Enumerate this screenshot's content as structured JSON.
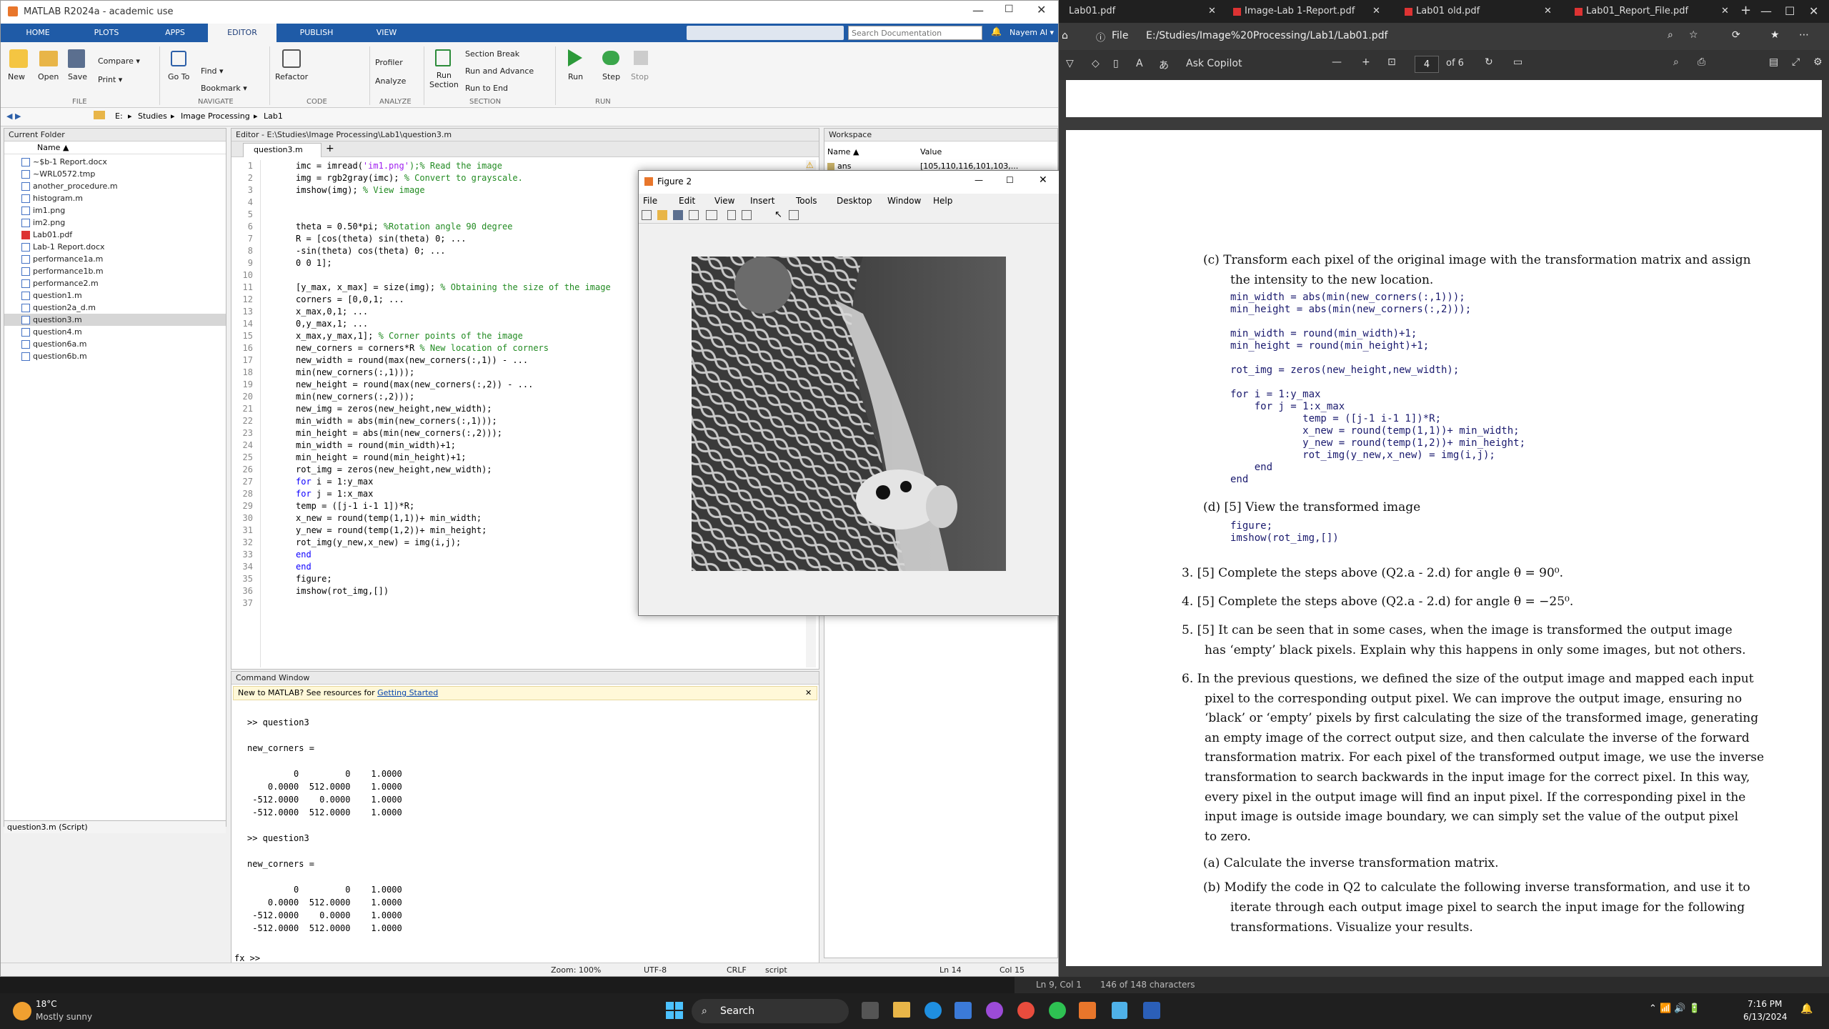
{
  "matlab": {
    "title": "MATLAB R2024a - academic use",
    "tabs": [
      "HOME",
      "PLOTS",
      "APPS",
      "EDITOR",
      "PUBLISH",
      "VIEW"
    ],
    "search_placeholder": "Search Documentation",
    "user": "Nayem Al ▾",
    "ribbon": {
      "new": "New",
      "open": "Open",
      "save": "Save",
      "compare": "Compare ▾",
      "print": "Print ▾",
      "goto": "Go To",
      "find": "Find ▾",
      "bookmark": "Bookmark ▾",
      "refactor": "Refactor",
      "profiler": "Profiler",
      "analyze": "Analyze",
      "run_section": "Run\nSection",
      "section_break": "Section Break",
      "run_advance": "Run and Advance",
      "run_end": "Run to End",
      "run": "Run",
      "step": "Step",
      "stop": "Stop",
      "groups": [
        "FILE",
        "NAVIGATE",
        "CODE",
        "ANALYZE",
        "SECTION",
        "RUN"
      ]
    },
    "path": [
      "E:",
      "Studies",
      "Image Processing",
      "Lab1"
    ],
    "current_folder": {
      "title": "Current Folder",
      "col": "Name ▲",
      "files": [
        "~$b-1 Report.docx",
        "~WRL0572.tmp",
        "another_procedure.m",
        "histogram.m",
        "im1.png",
        "im2.png",
        "Lab01.pdf",
        "Lab-1 Report.docx",
        "performance1a.m",
        "performance1b.m",
        "performance2.m",
        "question1.m",
        "question2a_d.m",
        "question3.m",
        "question4.m",
        "question6a.m",
        "question6b.m"
      ],
      "selected": "question3.m",
      "details": "question3.m  (Script)"
    },
    "editor": {
      "title": "Editor - E:\\Studies\\Image Processing\\Lab1\\question3.m",
      "tab": "question3.m",
      "lines": [
        [
          "imc = imread(",
          "'im1.png'",
          ");% Read the image"
        ],
        [
          "img = rgb2gray(imc); ",
          "",
          "% Convert to grayscale."
        ],
        [
          "imshow(img); ",
          "",
          "% View image"
        ],
        [
          "",
          "",
          ""
        ],
        [
          "",
          "",
          ""
        ],
        [
          "theta = 0.50*pi; ",
          "",
          "%Rotation angle 90 degree"
        ],
        [
          "R = [cos(theta) sin(theta) 0; ...",
          "",
          ""
        ],
        [
          "-sin(theta) cos(theta) 0; ...",
          "",
          ""
        ],
        [
          "0 0 1];",
          "",
          ""
        ],
        [
          "",
          "",
          ""
        ],
        [
          "[y_max, x_max] = size(img); ",
          "",
          "% Obtaining the size of the image"
        ],
        [
          "corners = [0,0,1; ...",
          "",
          ""
        ],
        [
          "x_max,0,1; ...",
          "",
          ""
        ],
        [
          "0,y_max,1; ...",
          "",
          ""
        ],
        [
          "x_max,y_max,1]; ",
          "",
          "% Corner points of the image"
        ],
        [
          "new_corners = corners*R ",
          "",
          "% New location of corners"
        ],
        [
          "new_width = round(max(new_corners(:,1)) - ...",
          "",
          ""
        ],
        [
          "min(new_corners(:,1)));",
          "",
          ""
        ],
        [
          "new_height = round(max(new_corners(:,2)) - ...",
          "",
          ""
        ],
        [
          "min(new_corners(:,2)));",
          "",
          ""
        ],
        [
          "new_img = zeros(new_height,new_width);",
          "",
          ""
        ],
        [
          "min_width = abs(min(new_corners(:,1)));",
          "",
          ""
        ],
        [
          "min_height = abs(min(new_corners(:,2)));",
          "",
          ""
        ],
        [
          "min_width = round(min_width)+1;",
          "",
          ""
        ],
        [
          "min_height = round(min_height)+1;",
          "",
          ""
        ],
        [
          "rot_img = zeros(new_height,new_width);",
          "",
          ""
        ],
        [
          "@for i = 1:y_max",
          "",
          ""
        ],
        [
          "@for j = 1:x_max",
          "",
          ""
        ],
        [
          "temp = ([j-1 i-1 1])*R;",
          "",
          ""
        ],
        [
          "x_new = round(temp(1,1))+ min_width;",
          "",
          ""
        ],
        [
          "y_new = round(temp(1,2))+ min_height;",
          "",
          ""
        ],
        [
          "rot_img(y_new,x_new) = img(i,j);",
          "",
          ""
        ],
        [
          "@end",
          "",
          ""
        ],
        [
          "@end",
          "",
          ""
        ],
        [
          "figure;",
          "",
          ""
        ],
        [
          "imshow(rot_img,[])",
          "",
          ""
        ],
        [
          "",
          "",
          ""
        ]
      ]
    },
    "command": {
      "title": "Command Window",
      "banner": "New to MATLAB? See resources for ",
      "banner_link": "Getting Started",
      "output": ">> question3\n\nnew_corners =\n\n         0         0    1.0000\n    0.0000  512.0000    1.0000\n -512.0000    0.0000    1.0000\n -512.0000  512.0000    1.0000\n\n>> question3\n\nnew_corners =\n\n         0         0    1.0000\n    0.0000  512.0000    1.0000\n -512.0000    0.0000    1.0000\n -512.0000  512.0000    1.0000",
      "prompt": "fx >>"
    },
    "workspace": {
      "title": "Workspace",
      "col_name": "Name ▲",
      "col_value": "Value",
      "var": "ans",
      "val": "[105,110,116,101,103,..."
    },
    "status": {
      "zoom": "Zoom: 100%",
      "enc": "UTF-8",
      "eol": "CRLF",
      "type": "script",
      "ln": "Ln  14",
      "col": "Col  15"
    }
  },
  "figure": {
    "title": "Figure 2",
    "menus": [
      "File",
      "Edit",
      "View",
      "Insert",
      "Tools",
      "Desktop",
      "Window",
      "Help"
    ]
  },
  "browser": {
    "tabs": [
      "Lab01.pdf",
      "Image-Lab 1-Report.pdf",
      "Lab01 old.pdf",
      "Lab01_Report_File.pdf"
    ],
    "url_label": "File",
    "url": "E:/Studies/Image%20Processing/Lab1/Lab01.pdf",
    "ask": "Ask Copilot",
    "page": "4",
    "of": "of 6",
    "status_left": "Ln 9, Col 1",
    "status_right": "146 of 148 characters"
  },
  "pdf": {
    "c_head": "(c)  Transform each pixel of the original image with the transformation matrix and assign",
    "c_head2": "the intensity to the new location.",
    "code_c": "min_width = abs(min(new_corners(:,1)));\nmin_height = abs(min(new_corners(:,2)));\n\nmin_width = round(min_width)+1;\nmin_height = round(min_height)+1;\n\nrot_img = zeros(new_height,new_width);\n\nfor i = 1:y_max\n    for j = 1:x_max\n            temp = ([j-1 i-1 1])*R;\n            x_new = round(temp(1,1))+ min_width;\n            y_new = round(temp(1,2))+ min_height;\n            rot_img(y_new,x_new) = img(i,j);\n    end\nend",
    "d_head": "(d)  [5] View the transformed image",
    "code_d": "figure;\nimshow(rot_img,[])",
    "q3": "3.  [5] Complete the steps above (Q2.a - 2.d) for angle θ = 90⁰.",
    "q4": "4.  [5] Complete the steps above (Q2.a - 2.d) for angle θ = −25⁰.",
    "q5": [
      "5.  [5] It can be seen that in some cases, when the image is transformed the output image",
      "has ‘empty’ black pixels. Explain why this happens in only some images, but not others."
    ],
    "q6": [
      "6.  In the previous questions, we defined the size of the output image and mapped each input",
      "pixel to the corresponding output pixel.  We can improve the output image, ensuring no",
      "‘black’ or ‘empty’ pixels by first calculating the size of the transformed image, generating",
      "an empty image of the correct output size, and then calculate the inverse of the forward",
      "transformation matrix.  For each pixel of the transformed output image, we use the inverse",
      "transformation to search backwards in the input image for the correct pixel.  In this way,",
      "every pixel in the output image will find an input pixel.  If the corresponding pixel in the",
      "input image is outside image boundary, we can simply set the value of the output pixel",
      "to zero."
    ],
    "q6a": "(a)  Calculate the inverse transformation matrix.",
    "q6b": [
      "(b)  Modify the code in Q2 to calculate the following inverse transformation, and use it to",
      "iterate through each output image pixel to search the input image for the following",
      "transformations.  Visualize your results."
    ]
  },
  "taskbar": {
    "temp": "18°C",
    "weather": "Mostly sunny",
    "search": "Search",
    "time": "7:16 PM",
    "date": "6/13/2024"
  }
}
